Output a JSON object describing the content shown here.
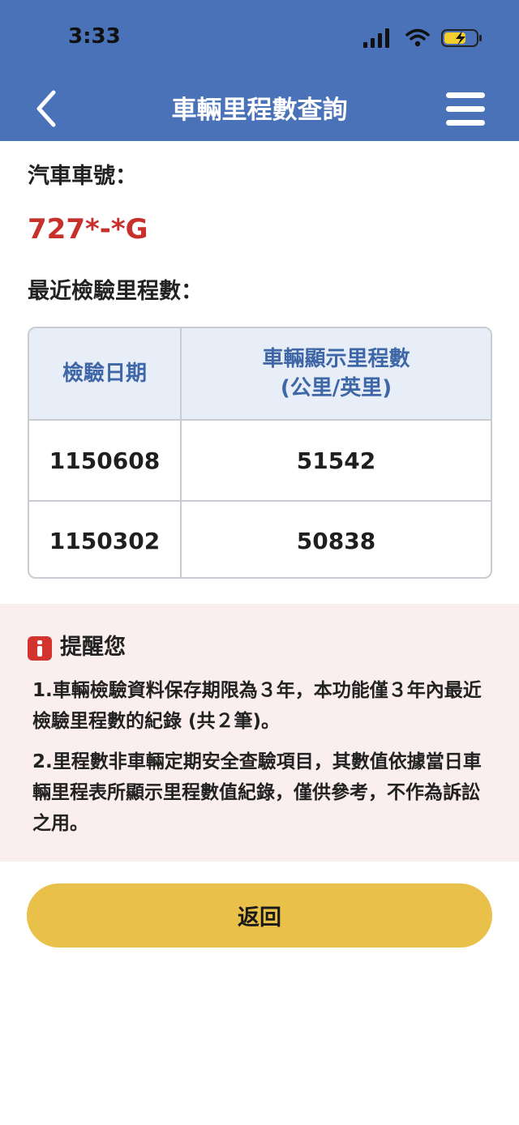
{
  "status_bar": {
    "time": "3:33"
  },
  "header": {
    "title": "車輛里程數查詢",
    "back_icon": "chevron-left-icon",
    "menu_icon": "hamburger-menu-icon",
    "background_color": "#4a72b8"
  },
  "vehicle": {
    "plate_label": "汽車車號：",
    "plate_number": "727*-*G"
  },
  "records": {
    "section_label": "最近檢驗里程數：",
    "columns": [
      "檢驗日期",
      "車輛顯示里程數",
      "(公里/英里)"
    ],
    "rows": [
      {
        "date": "1150608",
        "mileage": "51542"
      },
      {
        "date": "1150302",
        "mileage": "50838"
      }
    ]
  },
  "notice": {
    "icon": "info-icon",
    "title": "提醒您",
    "items": [
      "1.車輛檢驗資料保存期限為３年，本功能僅３年內最近檢驗里程數的紀錄 (共２筆)。",
      "2.里程數非車輛定期安全查驗項目，其數值依據當日車輛里程表所顯示里程數值紀錄，僅供參考，不作為訴訟之用。"
    ]
  },
  "actions": {
    "return_label": "返回",
    "return_color": "#e9c04a"
  }
}
